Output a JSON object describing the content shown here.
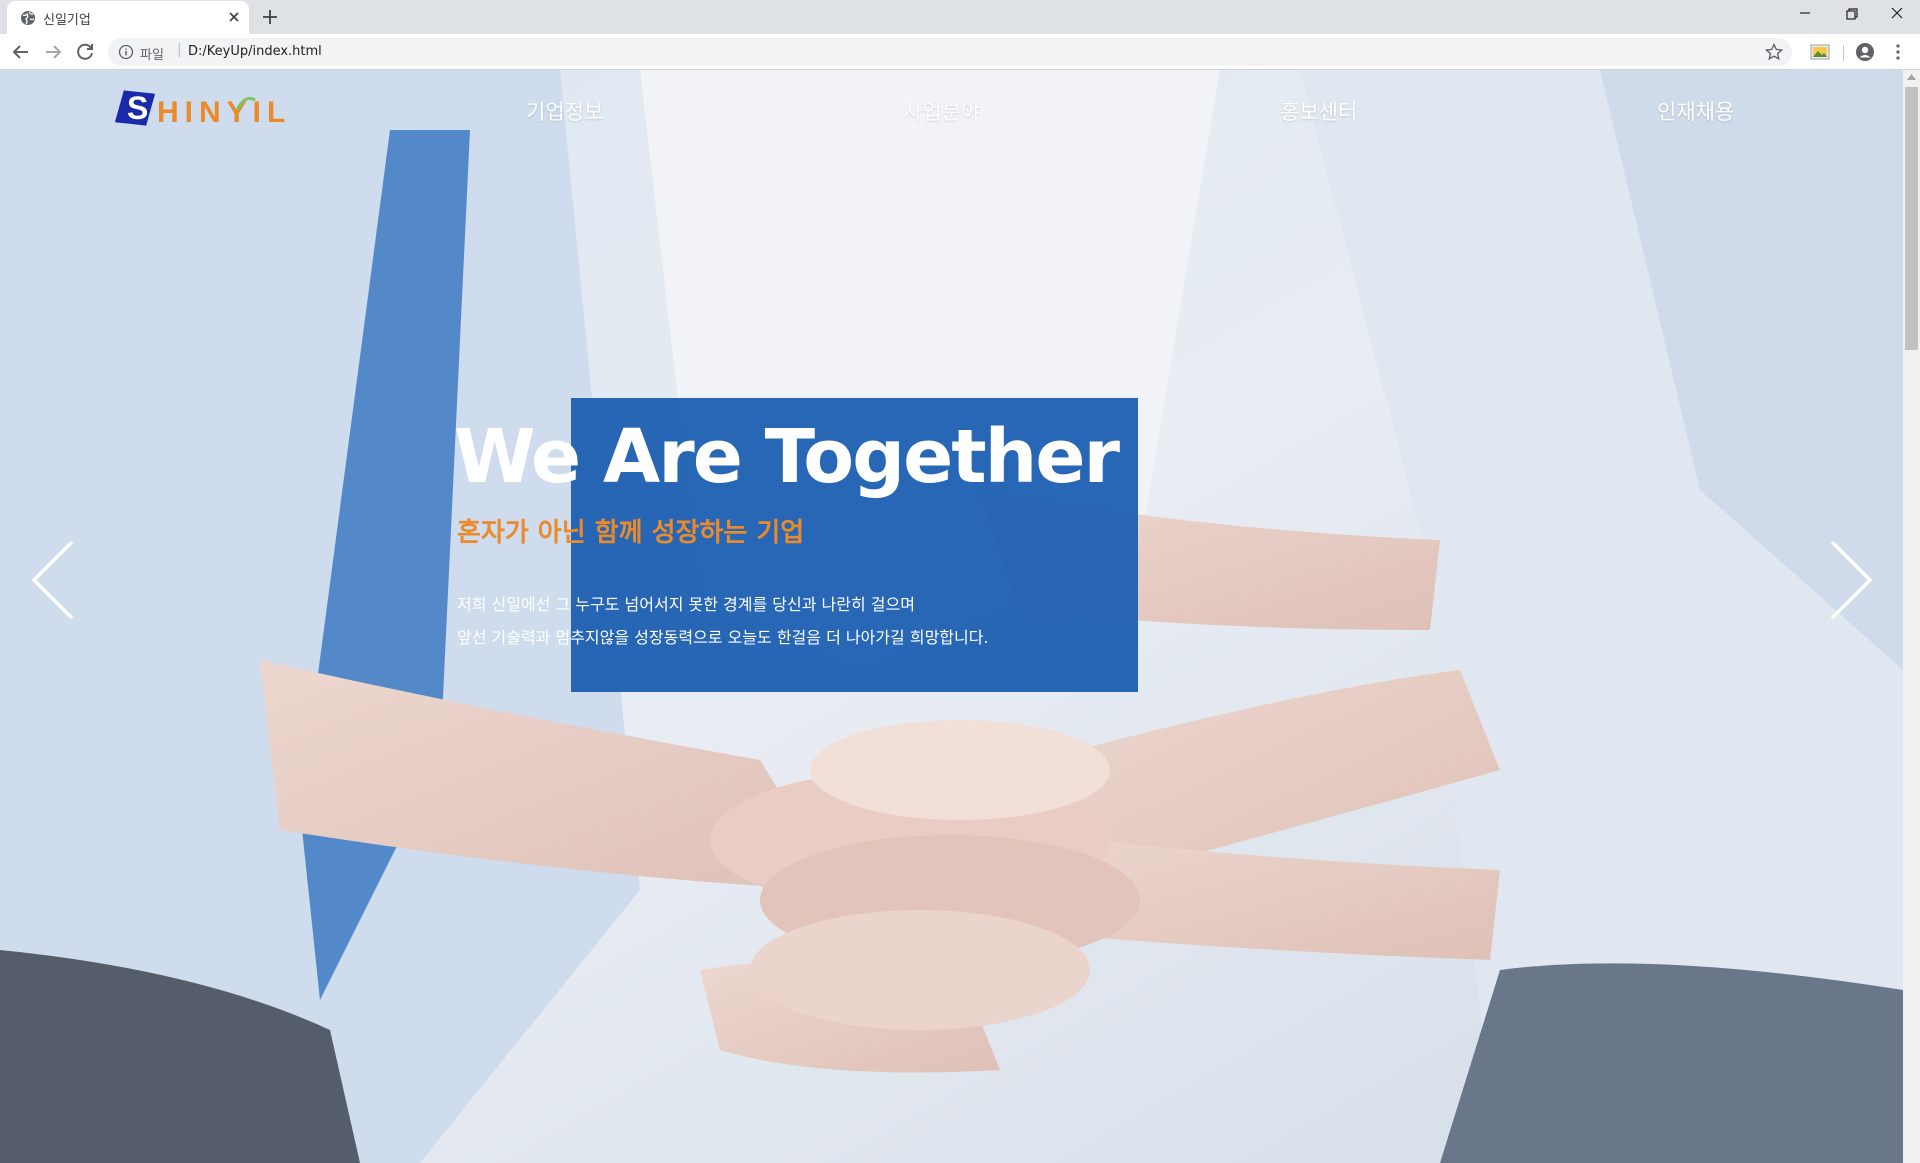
{
  "browser": {
    "tab_title": "신일기업",
    "address_scheme": "파일",
    "address_url": "D:/KeyUp/index.html"
  },
  "site": {
    "logo_letter": "S",
    "logo_rest": "HINYIL",
    "nav": [
      "기업정보",
      "사업분야",
      "홍보센터",
      "인재채용"
    ]
  },
  "hero": {
    "title": "We Are Together",
    "subtitle": "혼자가 아닌 함께 성장하는 기업",
    "description": [
      "저희 신일에선 그 누구도 넘어서지 못한 경계를 당신과 나란히 걸으며",
      "앞선 기술력과 멈추지않을 성장동력으로 오늘도 한걸음 더 나아가길 희망합니다."
    ]
  },
  "colors": {
    "brand_orange": "#e98a2c",
    "brand_blue": "#1a2aa8",
    "overlay_blue": "#1b5db0"
  }
}
